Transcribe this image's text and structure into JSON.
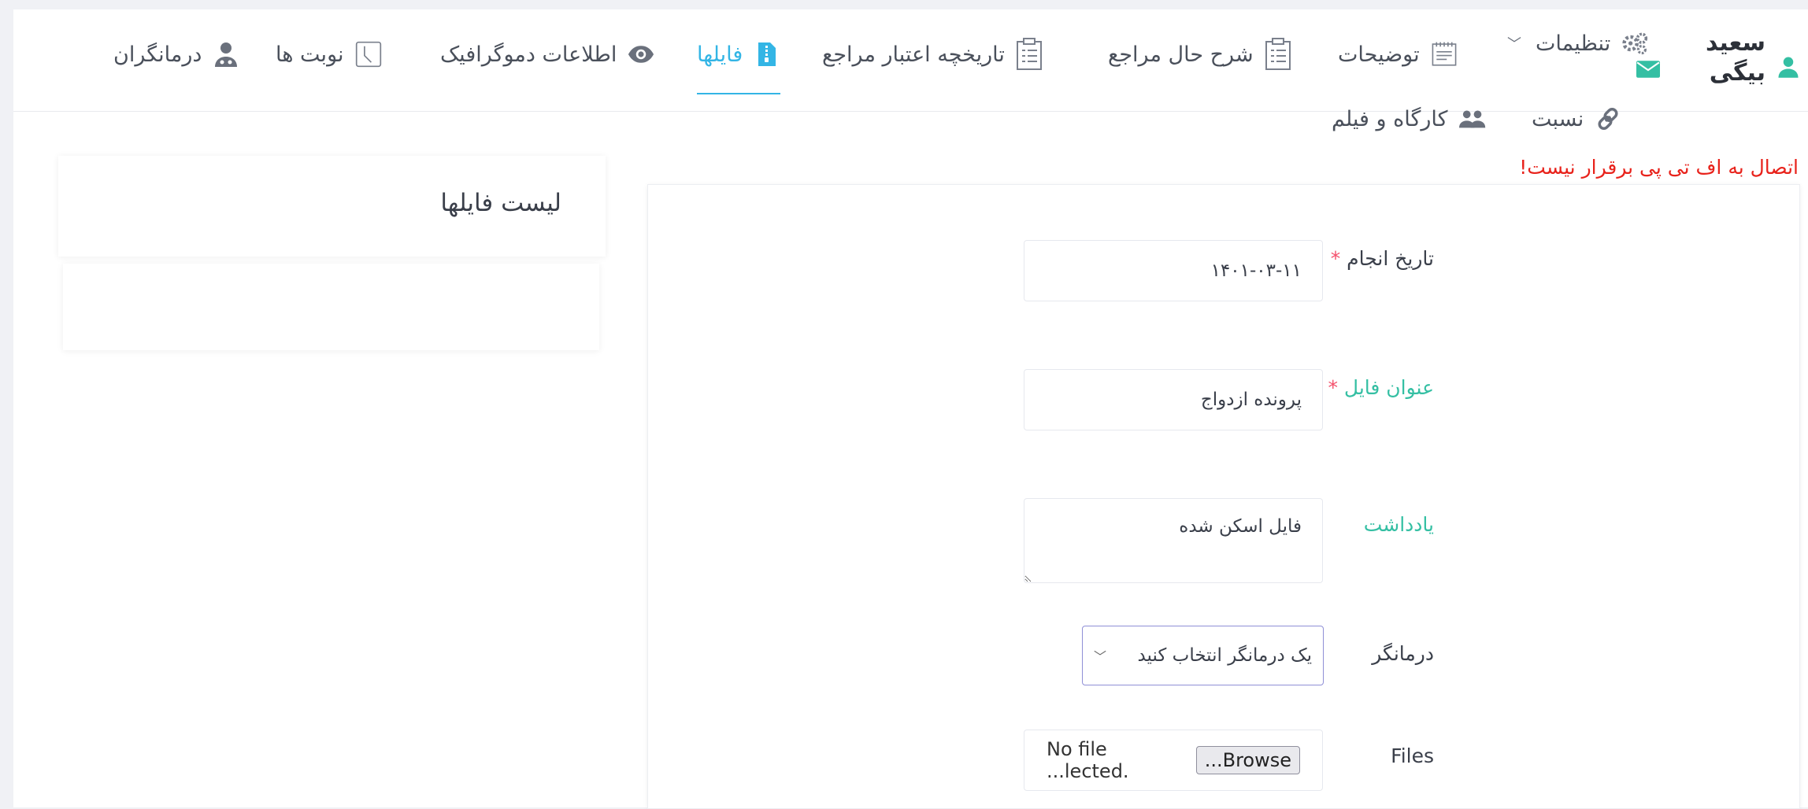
{
  "user": {
    "name": "سعید بیگی"
  },
  "nav": {
    "settings": "تنظیمات",
    "descriptions": "توضیحات",
    "case_history": "شرح حال مراجع",
    "credit_history": "تاریخچه اعتبار مراجع",
    "files": "فایلها",
    "demographic": "اطلاعات دموگرافیک",
    "appointments": "نوبت ها",
    "therapists": "درمانگران",
    "relation": "نسبت",
    "workshop": "کارگاه و فیلم"
  },
  "error_message": "اتصال به اف تی پی برقرار نیست!",
  "form": {
    "date_label": "تاریخ انجام",
    "date_value": "۱۴۰۱-۰۳-۱۱",
    "title_label": "عنوان فایل",
    "title_value": "پرونده ازدواج",
    "note_label": "یادداشت",
    "note_value": "فایل اسکن شده",
    "therapist_label": "درمانگر",
    "therapist_selected": "یک درمانگر انتخاب کنید",
    "files_label": "Files",
    "browse_label": "Browse...",
    "no_file_text": "No file ...lected."
  },
  "files_list": {
    "title": "لیست فایلها"
  },
  "colors": {
    "active_tab": "#33b5e5",
    "error": "#e8221b",
    "label_green": "#34bfa3",
    "required": "#f4516c",
    "user_icon": "#34bfa3"
  }
}
